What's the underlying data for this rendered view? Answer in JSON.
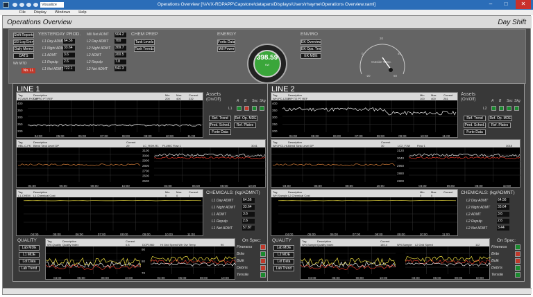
{
  "window": {
    "title": "Operations Overview    [\\\\VVX-RDPAPP\\Capstone\\datapars\\Displays\\Users\\rhayme\\Operations Overview.xaml]",
    "quick_select": "Visualize",
    "min": "–",
    "max": "□",
    "close": "✕"
  },
  "menu": [
    "File",
    "Display",
    "Windows",
    "Help"
  ],
  "page": {
    "title": "Operations Overview",
    "shift": "Day Shift"
  },
  "summary": {
    "buttons": [
      "Shift Reports",
      "3/3 Log Entry",
      "Daily Memo",
      "DATS"
    ],
    "yesterday_header": "YESTERDAY PROD.",
    "wk_mtd": "Wk MTD",
    "no_ll": "No. LL",
    "l1_rows": [
      {
        "label": "L1 Day ADMT",
        "value": "64.56"
      },
      {
        "label": "L1 Night ADMT",
        "value": "33.64"
      },
      {
        "label": "L1 ADMT",
        "value": "3.6"
      },
      {
        "label": "L1 Repulp",
        "value": "2.6"
      },
      {
        "label": "L1 Net ADMT",
        "value": "722.1"
      }
    ],
    "mill_header": "Mill Net ADMT",
    "mill_value": "904.2",
    "l2_rows": [
      {
        "label": "L2 Day ADMT",
        "value": "700"
      },
      {
        "label": "L2 Night ADMT",
        "value": "309.7"
      },
      {
        "label": "L2 ADMT",
        "value": "200.5"
      },
      {
        "label": "L2 Repulp",
        "value": "7.8"
      },
      {
        "label": "L2 Net ADMT",
        "value": "541.3"
      }
    ],
    "chem_header": "CHEM PREP",
    "chem_buttons": [
      "Tank Levels",
      "Tank Trends"
    ],
    "energy_header": "ENERGY",
    "energy_buttons": [
      "Fortis Data",
      "Mill Power"
    ],
    "gauge": {
      "value": "398.59",
      "unit": "KW",
      "fill_fraction": 0.7
    },
    "enviro_header": "ENVIRO",
    "enviro_buttons": [
      "EK Overview",
      "EK Ops. Trend",
      "EK MDE"
    ],
    "temp_label": "Outside Temp.",
    "temp_ticks": [
      "-20",
      "0",
      "20",
      "40",
      "60"
    ]
  },
  "lines": [
    {
      "name": "LINE 1",
      "chart1": {
        "tag": "FCVAIR-FKF-VIP",
        "desc": "DIP TO PT REF",
        "min": "200",
        "max": "400",
        "current": "232",
        "ylabels": [
          "400",
          "350",
          "300",
          "250",
          "200"
        ],
        "xlabels": [
          "04:00",
          "05:00",
          "06:00",
          "07:00",
          "08:00",
          "09:00",
          "10:00",
          "11:00"
        ]
      },
      "assets": {
        "title": "Assets",
        "sub": "(On/Off)",
        "cols": [
          "A",
          "B",
          "Sec",
          "Skg"
        ],
        "row": "L1"
      },
      "asset_buttons": [
        "Ref. Trend",
        "Ref. Op. MDE",
        "Prod. Sched.",
        "Ref. Plates",
        "Forte Data"
      ],
      "chart2": {
        "tag": "HBL-C-FK",
        "desc": "Blend Tank Level DP",
        "current": "29",
        "tag2": "LC_ROH-R1",
        "desc2": "PLUMC Flow 1",
        "current2": "3041",
        "ylabels": [
          "3100",
          "3000",
          "2900",
          "2800",
          "2700",
          "2600",
          "2500"
        ],
        "xlabels": [
          "04:00",
          "06:00",
          "08:00",
          "10:00"
        ]
      },
      "chart3": {
        "tag": "L1-CHEM",
        "desc": "L1 Chemical Cost",
        "min": "0",
        "max": "0",
        "current": "1",
        "xlabels": [
          "04:00",
          "05:00",
          "06:00",
          "07:00",
          "08:00",
          "09:00",
          "10:00",
          "11:00"
        ]
      },
      "chem": {
        "header": "CHEMICALS: (kg/ADMNT)",
        "rows": [
          {
            "label": "L1 Day ADMT",
            "value": "64.56"
          },
          {
            "label": "L1 Night ADMT",
            "value": "33.64"
          },
          {
            "label": "L1 ADMT",
            "value": "3.6"
          },
          {
            "label": "L1 Repulp",
            "value": "2.6"
          },
          {
            "label": "L1 Net ADMT",
            "value": "57.87"
          }
        ]
      },
      "quality": {
        "header": "QUALITY",
        "buttons": [
          "Lab MDE",
          "L1 MDE",
          "Lot Data",
          "Lab Trend"
        ],
        "tag": "WV-Quality",
        "desc": "Quality Index",
        "current": "0.8",
        "tag2": "DCP1960",
        "desc2": "Hi Grid Speed Wtr Ovr Temp",
        "current2": "90",
        "xlabels": [
          "04:00",
          "06:00",
          "08:00",
          "10:00"
        ],
        "ylabels": [
          "90",
          "80",
          "70"
        ]
      },
      "on_spec": {
        "header": "On Spec:",
        "items": [
          {
            "label": "Fineness",
            "color": "#c0392b"
          },
          {
            "label": "Brite",
            "color": "#1a8a2e"
          },
          {
            "label": "Bulk",
            "color": "#c0392b"
          },
          {
            "label": "Debris",
            "color": "#c0392b"
          },
          {
            "label": "Tensile",
            "color": "#1a8a2e"
          }
        ]
      },
      "asset_colors": [
        "#1a8a2e",
        "#c0392b",
        "#1a8a2e",
        "#1a8a2e"
      ]
    },
    {
      "name": "LINE 2",
      "chart1": {
        "tag": "WH-PC-L2DP",
        "desc": "DIP TO PT REF",
        "min": "100",
        "max": "400",
        "current": "281",
        "ylabels": [
          "400",
          "350",
          "300",
          "250",
          "200"
        ],
        "xlabels": [
          "04:00",
          "05:00",
          "06:00",
          "07:00",
          "08:00",
          "09:00",
          "10:00",
          "11:00"
        ]
      },
      "assets": {
        "title": "Assets",
        "sub": "(On/Off)",
        "cols": [
          "A",
          "B",
          "Sec",
          "Skg"
        ],
        "row": "L2"
      },
      "asset_buttons": [
        "Ref. Trend",
        "Ref. Op. MDE",
        "Prod. Sched.",
        "Ref. Plates",
        "Forte Data"
      ],
      "chart2": {
        "tag": "WH-PC1-HL",
        "desc": "Blend Tank Level DP",
        "current": "30",
        "tag2": "LC2_F1W",
        "desc2": "Flow 1",
        "current2": "3018",
        "ylabels": [
          "3120",
          "3040",
          "2960",
          "2880",
          "2800"
        ],
        "xlabels": [
          "04:00",
          "06:00",
          "08:00",
          "10:00"
        ]
      },
      "chart3": {
        "tag": "WH Sample",
        "desc": "L2 Chemical Cost",
        "min": "0",
        "max": "0",
        "current": "",
        "xlabels": [
          "04:00",
          "05:00",
          "06:00",
          "07:00",
          "08:00",
          "09:00",
          "10:00",
          "11:00"
        ]
      },
      "chem": {
        "header": "CHEMICALS: (kg/ADMNT)",
        "rows": [
          {
            "label": "L2 Day ADMT",
            "value": "64.56"
          },
          {
            "label": "L2 Night ADMT",
            "value": "33.64"
          },
          {
            "label": "L2 ADMT",
            "value": "3.6"
          },
          {
            "label": "L2 Repulp",
            "value": "2.6"
          },
          {
            "label": "L2 Net ADMT",
            "value": "3.44"
          }
        ]
      },
      "quality": {
        "header": "QUALITY",
        "buttons": [
          "Lab MDE",
          "L2 MDE",
          "Lot Data",
          "Lab Trend"
        ],
        "tag": "WH-Sample",
        "desc": "Quality Index",
        "current": "140.4",
        "tag2": "WH-Sample",
        "desc2": "L2 Grid Speed",
        "current2": "112",
        "xlabels": [
          "04:00",
          "06:00",
          "08:00",
          "10:00"
        ],
        "ylabels": [
          "",
          "",
          ""
        ]
      },
      "on_spec": {
        "header": "On Spec:",
        "items": [
          {
            "label": "Fineness",
            "color": "#1a8a2e"
          },
          {
            "label": "Brite",
            "color": "#c0392b"
          },
          {
            "label": "Bulk",
            "color": "#c0392b"
          },
          {
            "label": "Debris",
            "color": "#1a8a2e"
          },
          {
            "label": "Tensile",
            "color": "#1a8a2e"
          }
        ]
      },
      "asset_colors": [
        "#1a8a2e",
        "#1a8a2e",
        "#1a8a2e",
        "#1a8a2e"
      ]
    }
  ]
}
